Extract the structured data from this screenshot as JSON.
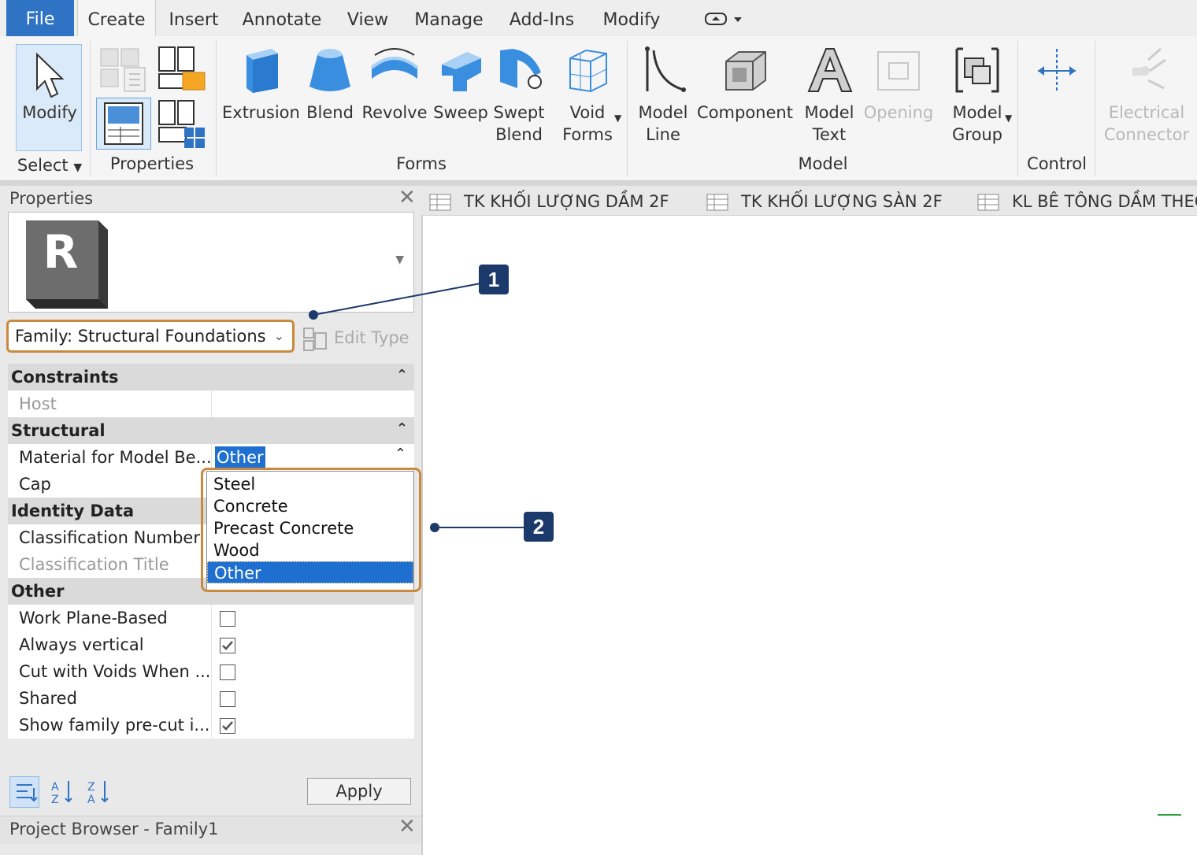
{
  "menu": {
    "tabs": [
      "File",
      "Create",
      "Insert",
      "Annotate",
      "View",
      "Manage",
      "Add-Ins",
      "Modify"
    ]
  },
  "ribbon": {
    "modify": "Modify",
    "select": "Select",
    "properties_panel": "Properties",
    "forms_panel": "Forms",
    "model_panel": "Model",
    "control_panel": "Control",
    "buttons": {
      "extrusion": "Extrusion",
      "blend": "Blend",
      "revolve": "Revolve",
      "sweep": "Sweep",
      "swept_blend_1": "Swept",
      "swept_blend_2": "Blend",
      "void_forms_1": "Void",
      "void_forms_2": "Forms",
      "model_line_1": "Model",
      "model_line_2": "Line",
      "component": "Component",
      "model_text_1": "Model",
      "model_text_2": "Text",
      "opening": "Opening",
      "model_group_1": "Model",
      "model_group_2": "Group",
      "control": "Control",
      "electrical_1": "Electrical",
      "electrical_2": "Connector"
    }
  },
  "properties": {
    "title": "Properties",
    "family": "Family: Structural Foundations",
    "edit_type": "Edit Type",
    "groups": {
      "constraints": "Constraints",
      "structural": "Structural",
      "identity": "Identity Data",
      "other": "Other"
    },
    "rows": {
      "host": "Host",
      "material": "Material for Model Be...",
      "material_value": "Other",
      "cap": "Cap",
      "class_number": "Classification Number",
      "class_title": "Classification Title",
      "work_plane": "Work Plane-Based",
      "always_vertical": "Always vertical",
      "cut_voids": "Cut with Voids When ...",
      "shared": "Shared",
      "show_precut": "Show family pre-cut i..."
    },
    "checks": {
      "work_plane": false,
      "always_vertical": true,
      "cut_voids": false,
      "shared": false,
      "show_precut": true
    },
    "dropdown_options": [
      "Steel",
      "Concrete",
      "Precast Concrete",
      "Wood",
      "Other"
    ],
    "selected_option": "Other",
    "apply": "Apply"
  },
  "project_browser": {
    "title": "Project Browser - Family1"
  },
  "view_tabs": [
    "TK KHỐI LƯỢNG DẦM 2F",
    "TK KHỐI LƯỢNG SÀN 2F",
    "KL BÊ TÔNG DẦM THEO"
  ],
  "callouts": {
    "one": "1",
    "two": "2"
  },
  "colors": {
    "accent": "#2f73c4",
    "highlight": "#c98a3e",
    "selection": "#1f6fd1",
    "badge": "#1b3a6b"
  }
}
